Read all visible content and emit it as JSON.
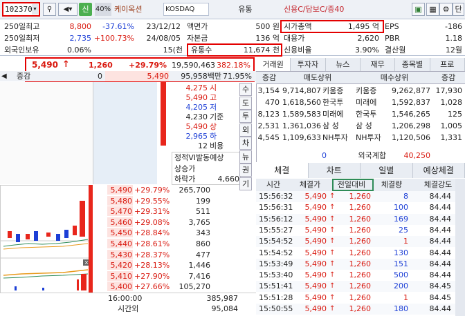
{
  "toolbar": {
    "code": "102370",
    "sin": "신",
    "pct": "40%",
    "name": "케이옥션",
    "market": "KOSDAQ",
    "industry": "유통",
    "credit": "신용C/담보C/증40",
    "icons": [
      "search-icon",
      "speaker-icon",
      "lock-icon",
      "window-icon",
      "grid-icon",
      "gear-icon",
      "close-icon"
    ],
    "dan": "단"
  },
  "info": {
    "r1": {
      "l1": "250일최고",
      "v1": "8,800",
      "p1": "-37.61%",
      "d1": "23/12/12",
      "l2": "액면가",
      "v2": "500 원",
      "l3": "시가총액",
      "v3": "1,495 억",
      "l4": "EPS",
      "v4": "-186"
    },
    "r2": {
      "l1": "250일최저",
      "v1": "2,735",
      "p1": "+100.73%",
      "d1": "24/08/05",
      "l2": "자본금",
      "v2": "136 억",
      "l3": "대용가",
      "v3": "2,620",
      "l4": "PBR",
      "v4": "1.18"
    },
    "r3": {
      "l1": "외국인보유",
      "v1": "0.06%",
      "v1b": "15(천",
      "l2": "유통수",
      "v2": "11,674 천",
      "l3": "신용비율",
      "v3": "3.90%",
      "l4": "결산월",
      "v4": "12월"
    }
  },
  "price": {
    "cur": "5,490",
    "arrow": "↑",
    "chg": "1,260",
    "rate": "+29.79%",
    "vol": "19,590,463",
    "ratio": "382.18%",
    "label2": "증감",
    "val2": "0",
    "cur2": "5,490",
    "amt": "95,958백만",
    "ratio2": "71.95%"
  },
  "right_info": [
    {
      "v": "4,275",
      "l": "시",
      "c": "red"
    },
    {
      "v": "5,490",
      "l": "고",
      "c": "red"
    },
    {
      "v": "4,205",
      "l": "저",
      "c": "blue"
    },
    {
      "v": "4,230",
      "l": "기준",
      "c": ""
    },
    {
      "v": "5,490",
      "l": "상",
      "c": "red"
    },
    {
      "v": "2,965",
      "l": "하",
      "c": "blue"
    },
    {
      "v": "12",
      "l": "비용",
      "c": ""
    }
  ],
  "vi": {
    "title": "정적VI발동예상",
    "up": "상승가",
    "down": "하락가",
    "down_val": "4,660"
  },
  "vtabs": [
    "수",
    "도",
    "투",
    "외",
    "차",
    "뉴",
    "권",
    "기"
  ],
  "orderbook": [
    {
      "p": "5,490",
      "r": "+29.79%",
      "q": "265,700"
    },
    {
      "p": "5,480",
      "r": "+29.55%",
      "q": "199"
    },
    {
      "p": "5,470",
      "r": "+29.31%",
      "q": "511"
    },
    {
      "p": "5,460",
      "r": "+29.08%",
      "q": "3,765"
    },
    {
      "p": "5,450",
      "r": "+28.84%",
      "q": "343"
    },
    {
      "p": "5,440",
      "r": "+28.61%",
      "q": "860"
    },
    {
      "p": "5,430",
      "r": "+28.37%",
      "q": "477"
    },
    {
      "p": "5,420",
      "r": "+28.13%",
      "q": "1,446"
    },
    {
      "p": "5,410",
      "r": "+27.90%",
      "q": "7,416"
    },
    {
      "p": "5,400",
      "r": "+27.66%",
      "q": "105,270"
    }
  ],
  "ob_bottom": {
    "t1": "16:00:00",
    "v1": "385,987",
    "t2": "시간외",
    "v2": "95,084"
  },
  "broker_tabs": [
    "거래원",
    "투자자",
    "뉴스",
    "재무",
    "종목별",
    "프로"
  ],
  "broker": {
    "h": [
      "증감",
      "매도상위",
      "매수상위",
      "증감"
    ],
    "rows": [
      {
        "a": "3,154",
        "b": "9,714,807",
        "c": "키움증",
        "d": "키움증",
        "e": "9,262,877",
        "f": "17,930"
      },
      {
        "a": "470",
        "b": "1,618,560",
        "c": "한국투",
        "d": "미래에",
        "e": "1,592,837",
        "f": "1,028"
      },
      {
        "a": "8,123",
        "b": "1,589,583",
        "c": "미래에",
        "d": "한국투",
        "e": "1,546,265",
        "f": "125"
      },
      {
        "a": "2,531",
        "b": "1,361,036",
        "c": "삼 성",
        "d": "삼 성",
        "e": "1,206,298",
        "f": "1,005"
      },
      {
        "a": "4,545",
        "b": "1,109,633",
        "c": "NH투자",
        "d": "NH투자",
        "e": "1,120,506",
        "f": "1,331"
      }
    ],
    "foot": {
      "a": "0",
      "label": "외국계합",
      "val": "40,250"
    }
  },
  "trade_tabs": [
    "체결",
    "차트",
    "일별",
    "예상체결"
  ],
  "trades": {
    "h": [
      "시간",
      "체결가",
      "전일대비",
      "체결량",
      "체결강도"
    ],
    "rows": [
      {
        "t": "15:56:32",
        "p": "5,490",
        "d": "1,260",
        "q": "8",
        "s": "84.44",
        "c": "blue"
      },
      {
        "t": "15:56:31",
        "p": "5,490",
        "d": "1,260",
        "q": "100",
        "s": "84.44",
        "c": "blue"
      },
      {
        "t": "15:56:12",
        "p": "5,490",
        "d": "1,260",
        "q": "169",
        "s": "84.44",
        "c": "blue"
      },
      {
        "t": "15:55:27",
        "p": "5,490",
        "d": "1,260",
        "q": "25",
        "s": "84.44",
        "c": "blue"
      },
      {
        "t": "15:54:52",
        "p": "5,490",
        "d": "1,260",
        "q": "1",
        "s": "84.44",
        "c": "red"
      },
      {
        "t": "15:54:52",
        "p": "5,490",
        "d": "1,260",
        "q": "130",
        "s": "84.44",
        "c": "blue"
      },
      {
        "t": "15:53:49",
        "p": "5,490",
        "d": "1,260",
        "q": "151",
        "s": "84.44",
        "c": "blue"
      },
      {
        "t": "15:53:40",
        "p": "5,490",
        "d": "1,260",
        "q": "500",
        "s": "84.44",
        "c": "blue"
      },
      {
        "t": "15:51:41",
        "p": "5,490",
        "d": "1,260",
        "q": "200",
        "s": "84.45",
        "c": "blue"
      },
      {
        "t": "15:51:28",
        "p": "5,490",
        "d": "1,260",
        "q": "1",
        "s": "84.45",
        "c": "red"
      },
      {
        "t": "15:50:55",
        "p": "5,490",
        "d": "1,260",
        "q": "180",
        "s": "84.44",
        "c": "blue"
      }
    ]
  }
}
